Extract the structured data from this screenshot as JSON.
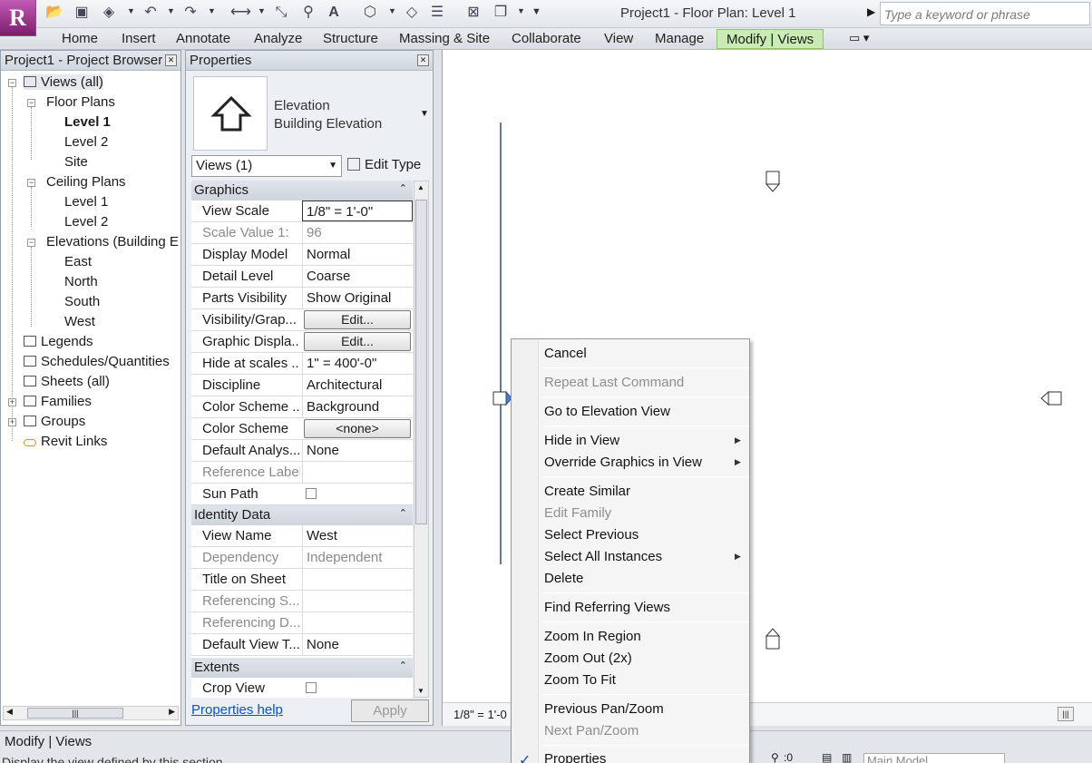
{
  "window": {
    "title": "Project1 - Floor Plan: Level 1",
    "search_placeholder": "Type a keyword or phrase"
  },
  "ribbon": {
    "tabs": [
      "Home",
      "Insert",
      "Annotate",
      "Analyze",
      "Structure",
      "Massing & Site",
      "Collaborate",
      "View",
      "Manage"
    ],
    "active_tab": "Modify | Views"
  },
  "browser": {
    "title": "Project1 - Project Browser",
    "items": [
      {
        "label": "Views (all)"
      },
      {
        "label": "Floor Plans"
      },
      {
        "label": "Level 1"
      },
      {
        "label": "Level 2"
      },
      {
        "label": "Site"
      },
      {
        "label": "Ceiling Plans"
      },
      {
        "label": "Level 1"
      },
      {
        "label": "Level 2"
      },
      {
        "label": "Elevations (Building Elevation)"
      },
      {
        "label": "East"
      },
      {
        "label": "North"
      },
      {
        "label": "South"
      },
      {
        "label": "West"
      },
      {
        "label": "Legends"
      },
      {
        "label": "Schedules/Quantities"
      },
      {
        "label": "Sheets (all)"
      },
      {
        "label": "Families"
      },
      {
        "label": "Groups"
      },
      {
        "label": "Revit Links"
      }
    ]
  },
  "properties": {
    "title": "Properties",
    "type_line1": "Elevation",
    "type_line2": "Building Elevation",
    "selector": "Views (1)",
    "edit_type": "Edit Type",
    "groups": {
      "graphics": "Graphics",
      "identity": "Identity Data",
      "extents": "Extents"
    },
    "rows": [
      {
        "name": "View Scale",
        "value": "1/8\" = 1'-0\""
      },
      {
        "name": "Scale Value    1:",
        "value": "96"
      },
      {
        "name": "Display Model",
        "value": "Normal"
      },
      {
        "name": "Detail Level",
        "value": "Coarse"
      },
      {
        "name": "Parts Visibility",
        "value": "Show Original"
      },
      {
        "name": "Visibility/Grap...",
        "value": "Edit..."
      },
      {
        "name": "Graphic Displa...",
        "value": "Edit..."
      },
      {
        "name": "Hide at scales ...",
        "value": "1\" = 400'-0\""
      },
      {
        "name": "Discipline",
        "value": "Architectural"
      },
      {
        "name": "Color Scheme ...",
        "value": "Background"
      },
      {
        "name": "Color Scheme",
        "value": "<none>"
      },
      {
        "name": "Default Analys...",
        "value": "None"
      },
      {
        "name": "Reference Label",
        "value": ""
      },
      {
        "name": "Sun Path",
        "value": ""
      },
      {
        "name": "View Name",
        "value": "West"
      },
      {
        "name": "Dependency",
        "value": "Independent"
      },
      {
        "name": "Title on Sheet",
        "value": ""
      },
      {
        "name": "Referencing S...",
        "value": ""
      },
      {
        "name": "Referencing D...",
        "value": ""
      },
      {
        "name": "Default View T...",
        "value": "None"
      },
      {
        "name": "Crop View",
        "value": ""
      }
    ],
    "help": "Properties help",
    "apply": "Apply"
  },
  "canvas": {
    "scale": "1/8\" = 1'-0"
  },
  "status": {
    "label": "Modify | Views",
    "hint": "Display the view defined by this section.",
    "zero": ":0",
    "model": "Main Model"
  },
  "context_menu": {
    "items": [
      "Cancel",
      "Repeat Last Command",
      "Go to Elevation View",
      "Hide in View",
      "Override Graphics in View",
      "Create Similar",
      "Edit Family",
      "Select Previous",
      "Select All Instances",
      "Delete",
      "Find Referring Views",
      "Zoom In Region",
      "Zoom Out (2x)",
      "Zoom To Fit",
      "Previous Pan/Zoom",
      "Next Pan/Zoom",
      "Properties"
    ]
  },
  "colors": {
    "active_tab": "#c8ecb4",
    "check": "#1e4aa8"
  }
}
